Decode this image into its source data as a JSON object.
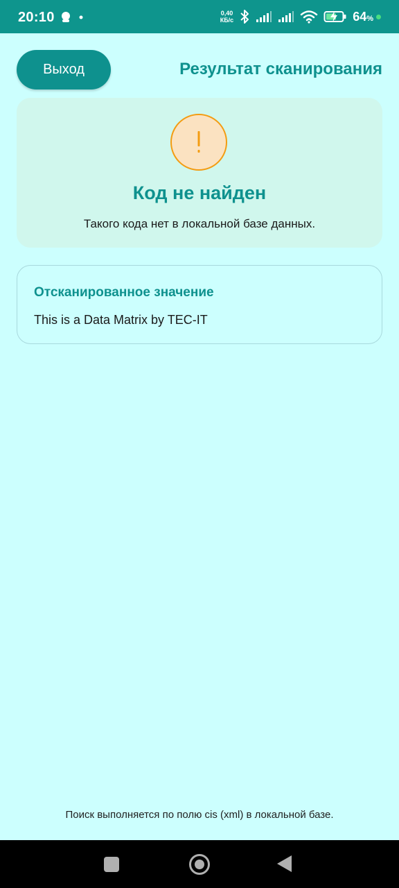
{
  "status_bar": {
    "time": "20:10",
    "net_speed_value": "0,40",
    "net_speed_unit": "КБ/с",
    "battery_percent": "64",
    "battery_unit": "%",
    "icons": [
      "notification-bulb-icon",
      "dot-icon",
      "bluetooth-icon",
      "signal-icon",
      "signal-icon",
      "wifi-icon",
      "battery-charging-icon"
    ],
    "battery_dot_color": "#4ade80"
  },
  "header": {
    "exit_label": "Выход",
    "title": "Результат сканирования"
  },
  "result": {
    "icon": "warning-icon",
    "icon_glyph": "!",
    "title": "Код не найден",
    "description": "Такого кода нет в локальной базе данных."
  },
  "scan": {
    "label": "Отсканированное значение",
    "value": "This is a Data Matrix by TEC-IT"
  },
  "footer": {
    "note": "Поиск выполняется по полю cis (xml) в локальной базе."
  },
  "nav": {
    "icons": [
      "recents-icon",
      "home-icon",
      "back-icon"
    ]
  },
  "colors": {
    "accent": "#0e918e",
    "background": "#ccfffe",
    "result_card": "#d0f7ed",
    "warning_border": "#f39c12",
    "warning_fill": "#fbe2c1"
  }
}
